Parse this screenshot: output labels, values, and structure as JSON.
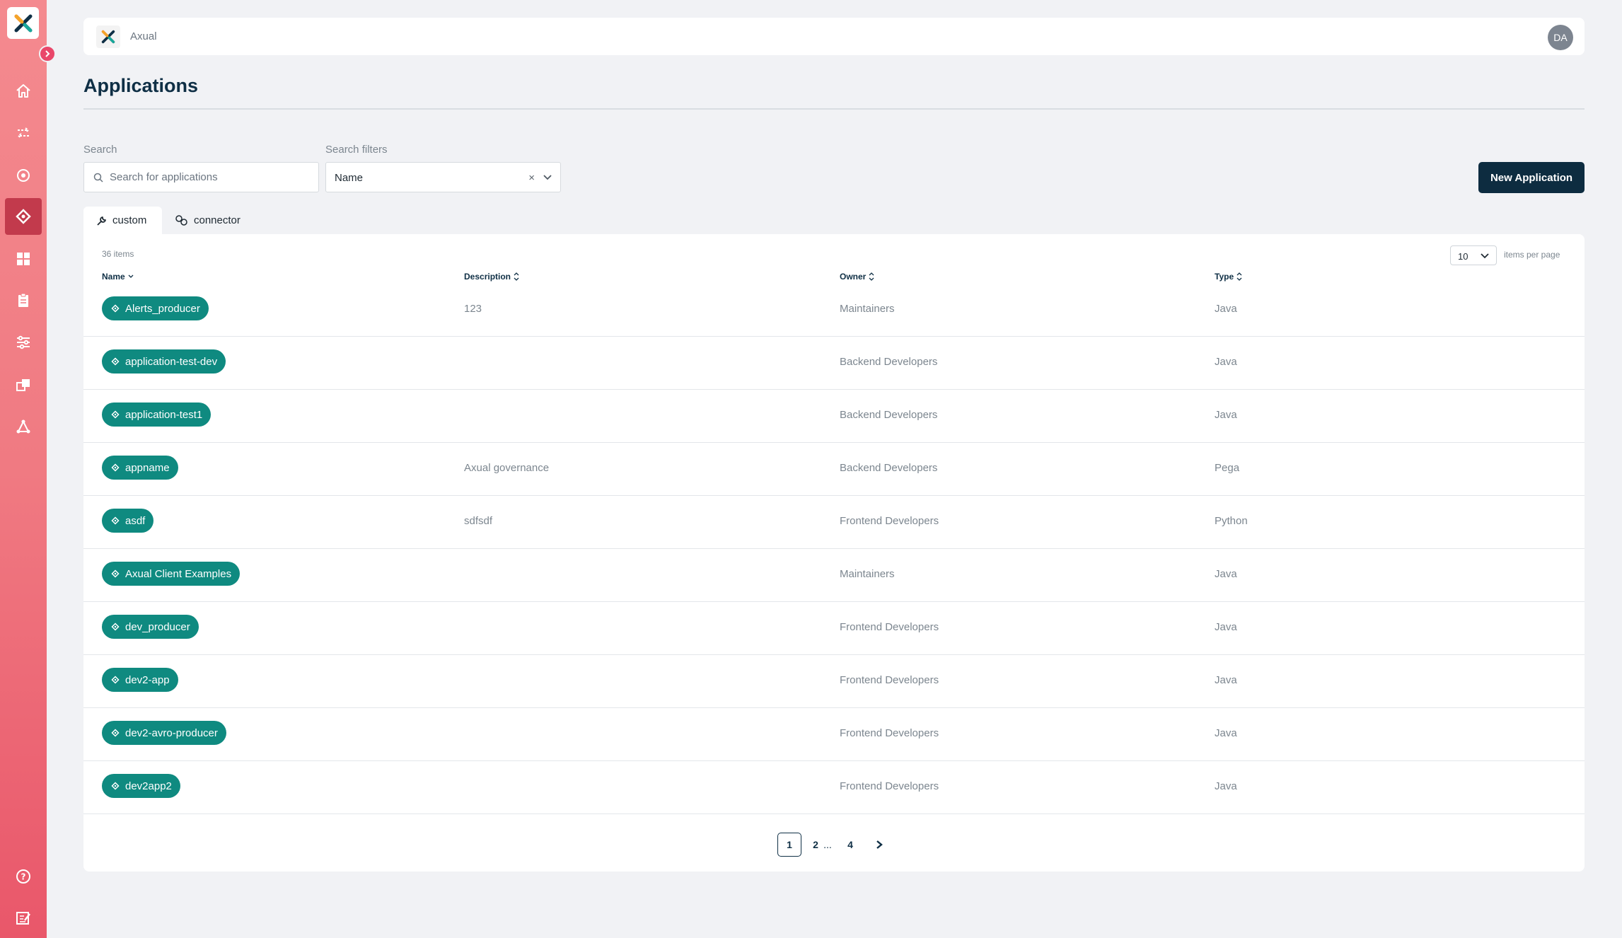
{
  "header": {
    "brand_name": "Axual",
    "avatar_initials": "DA"
  },
  "sidebar": {
    "items": [
      {
        "icon": "home-icon",
        "active": false
      },
      {
        "icon": "streams-icon",
        "active": false
      },
      {
        "icon": "topics-icon",
        "active": false
      },
      {
        "icon": "applications-icon",
        "active": true
      },
      {
        "icon": "dashboard-icon",
        "active": false
      },
      {
        "icon": "schemas-icon",
        "active": false
      },
      {
        "icon": "settings-sliders-icon",
        "active": false
      },
      {
        "icon": "environments-icon",
        "active": false
      },
      {
        "icon": "topology-icon",
        "active": false
      }
    ],
    "bottom_items": [
      {
        "icon": "help-icon"
      },
      {
        "icon": "feedback-icon"
      }
    ]
  },
  "page": {
    "title": "Applications"
  },
  "search": {
    "label": "Search",
    "placeholder": "Search for applications"
  },
  "filters": {
    "label": "Search filters",
    "selected": "Name",
    "clear": "×"
  },
  "actions": {
    "new_application": "New Application"
  },
  "tabs": [
    {
      "label": "custom",
      "icon": "wrench-icon",
      "active": true
    },
    {
      "label": "connector",
      "icon": "connector-icon",
      "active": false
    }
  ],
  "table": {
    "items_count": "36 items",
    "per_page": "10",
    "per_page_label": "items per page",
    "columns": [
      "Name",
      "Description",
      "Owner",
      "Type"
    ],
    "rows": [
      {
        "name": "Alerts_producer",
        "description": "123",
        "owner": "Maintainers",
        "type": "Java"
      },
      {
        "name": "application-test-dev",
        "description": "",
        "owner": "Backend Developers",
        "type": "Java"
      },
      {
        "name": "application-test1",
        "description": "",
        "owner": "Backend Developers",
        "type": "Java"
      },
      {
        "name": "appname",
        "description": "Axual governance",
        "owner": "Backend Developers",
        "type": "Pega"
      },
      {
        "name": "asdf",
        "description": "sdfsdf",
        "owner": "Frontend Developers",
        "type": "Python"
      },
      {
        "name": "Axual Client Examples",
        "description": "",
        "owner": "Maintainers",
        "type": "Java"
      },
      {
        "name": "dev_producer",
        "description": "",
        "owner": "Frontend Developers",
        "type": "Java"
      },
      {
        "name": "dev2-app",
        "description": "",
        "owner": "Frontend Developers",
        "type": "Java"
      },
      {
        "name": "dev2-avro-producer",
        "description": "",
        "owner": "Frontend Developers",
        "type": "Java"
      },
      {
        "name": "dev2app2",
        "description": "",
        "owner": "Frontend Developers",
        "type": "Java"
      }
    ]
  },
  "pagination": {
    "current": "1",
    "pages": [
      "1",
      "2",
      "4"
    ],
    "ellipsis": "...",
    "next": "next"
  },
  "colors": {
    "accent": "#0f8a80",
    "primary": "#0d2c40",
    "sidebar": "#f07a82",
    "active_nav": "#c23a4c"
  }
}
